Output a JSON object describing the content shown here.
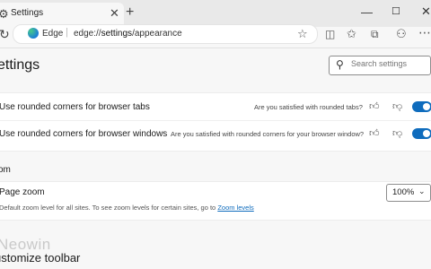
{
  "tab": {
    "title": "Settings",
    "close_glyph": "✕",
    "icon": "settings-gear-icon"
  },
  "window": {
    "new_tab": "+",
    "minimize": "—",
    "maximize": "☐",
    "close": "✕"
  },
  "address_bar": {
    "site_label": "Edge",
    "separator": "|",
    "url_prefix": "edge://",
    "url_bold": "settings",
    "url_suffix": "/appearance"
  },
  "page": {
    "title": "ettings"
  },
  "search": {
    "placeholder": "Search settings"
  },
  "rows": [
    {
      "label": "Use rounded corners for browser tabs",
      "feedback": "Are you satisfied with rounded tabs?",
      "enabled": true
    },
    {
      "label": "Use rounded corners for browser windows",
      "feedback": "Are you satisfied with rounded corners for your browser window?",
      "enabled": true
    }
  ],
  "zoom": {
    "heading": "om",
    "label": "Page zoom",
    "description": "Default zoom level for all sites. To see zoom levels for certain sites, go to ",
    "link": "Zoom levels",
    "value": "100%"
  },
  "watermark": "Neowin",
  "next_section": "ustomize toolbar",
  "colors": {
    "accent": "#0f6cbd",
    "tabstrip": "#e9e9e9",
    "page_bg": "#f7f7f7"
  }
}
